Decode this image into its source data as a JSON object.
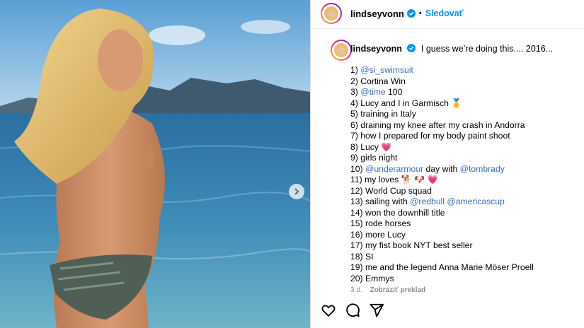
{
  "post": {
    "username": "lindseyvonn",
    "dot": "•",
    "follow_label": "Sledovať",
    "caption_intro": "I guess we’re doing this.... 2016...",
    "items": [
      {
        "num": "1)",
        "parts": [
          {
            "t": "@si_swimsuit",
            "m": true
          }
        ]
      },
      {
        "num": "2)",
        "parts": [
          {
            "t": "Cortina Win",
            "m": false
          }
        ]
      },
      {
        "num": "3)",
        "parts": [
          {
            "t": "@time",
            "m": true
          },
          {
            "t": " 100",
            "m": false
          }
        ]
      },
      {
        "num": "4)",
        "parts": [
          {
            "t": "Lucy and I in Garmisch 🥇",
            "m": false
          }
        ]
      },
      {
        "num": "5)",
        "parts": [
          {
            "t": "training in Italy",
            "m": false
          }
        ]
      },
      {
        "num": "6)",
        "parts": [
          {
            "t": "draining my knee after my crash in Andorra",
            "m": false
          }
        ]
      },
      {
        "num": "7)",
        "parts": [
          {
            "t": "how I prepared for my body paint shoot",
            "m": false
          }
        ]
      },
      {
        "num": "8)",
        "parts": [
          {
            "t": "Lucy 💗",
            "m": false
          }
        ]
      },
      {
        "num": "9)",
        "parts": [
          {
            "t": "girls night",
            "m": false
          }
        ]
      },
      {
        "num": "10)",
        "parts": [
          {
            "t": "@underarmour",
            "m": true
          },
          {
            "t": " day with ",
            "m": false
          },
          {
            "t": "@tombrady",
            "m": true
          }
        ]
      },
      {
        "num": "11)",
        "parts": [
          {
            "t": "my loves 🐕 🐶 💗",
            "m": false
          }
        ]
      },
      {
        "num": "12)",
        "parts": [
          {
            "t": "World Cup squad",
            "m": false
          }
        ]
      },
      {
        "num": "13)",
        "parts": [
          {
            "t": "sailing with ",
            "m": false
          },
          {
            "t": "@redbull",
            "m": true
          },
          {
            "t": " ",
            "m": false
          },
          {
            "t": "@americascup",
            "m": true
          }
        ]
      },
      {
        "num": "14)",
        "parts": [
          {
            "t": "won the downhill title",
            "m": false
          }
        ]
      },
      {
        "num": "15)",
        "parts": [
          {
            "t": "rode horses",
            "m": false
          }
        ]
      },
      {
        "num": "16)",
        "parts": [
          {
            "t": "more Lucy",
            "m": false
          }
        ]
      },
      {
        "num": "17)",
        "parts": [
          {
            "t": "my fist book NYT best seller",
            "m": false
          }
        ]
      },
      {
        "num": "18)",
        "parts": [
          {
            "t": "SI",
            "m": false
          }
        ]
      },
      {
        "num": "19)",
        "parts": [
          {
            "t": "me and the legend Anna Marie Möser Proell",
            "m": false
          }
        ]
      },
      {
        "num": "20)",
        "parts": [
          {
            "t": "Emmys",
            "m": false
          }
        ]
      }
    ],
    "time_ago": "3 d.",
    "translate_label": "Zobraziť preklad"
  },
  "icons": {
    "like": "heart-icon",
    "comment": "comment-icon",
    "share": "share-icon",
    "next": "chevron-right-icon",
    "verified": "verified-badge-icon"
  },
  "colors": {
    "link": "#0095f6",
    "mention": "#3a6fb8",
    "verified": "#0095f6",
    "meta": "#8e8e8e"
  }
}
